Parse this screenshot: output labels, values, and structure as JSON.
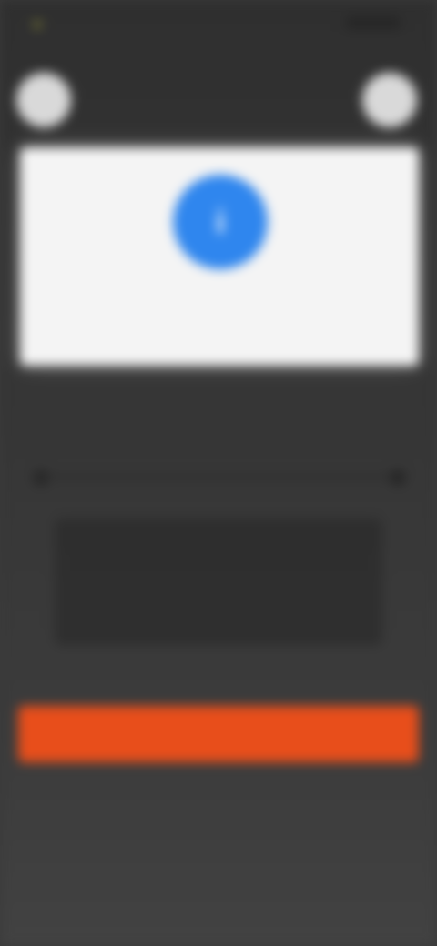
{
  "status_bar": {
    "time": "",
    "carrier": ""
  },
  "header": {
    "left_button_icon": "close-icon",
    "right_button_icon": "more-icon"
  },
  "card": {
    "icon": "info-icon",
    "icon_glyph": "i",
    "title": "",
    "subtitle": ""
  },
  "action": {
    "label": ""
  },
  "colors": {
    "background": "#363636",
    "card": "#f4f4f4",
    "accent_blue": "#2f86ee",
    "action_orange": "#e84e1b"
  }
}
